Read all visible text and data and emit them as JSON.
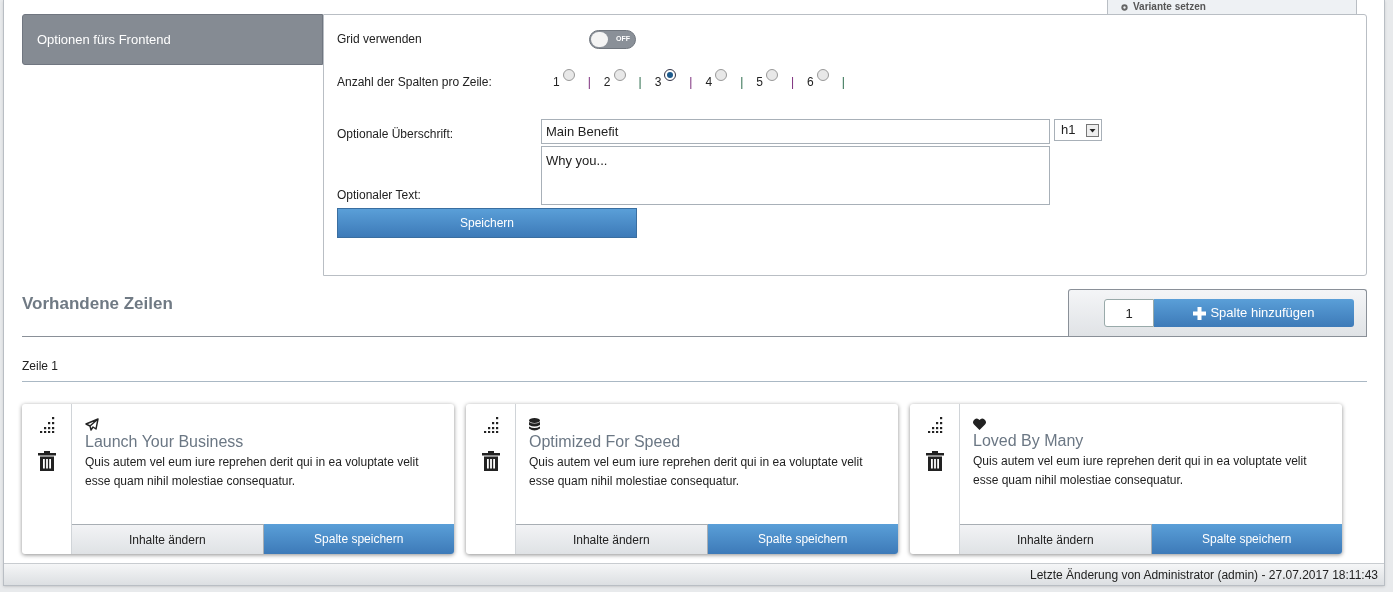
{
  "top_tab": {
    "label": "Variante setzen"
  },
  "options_tab": {
    "label": "Optionen fürs Frontend"
  },
  "grid_toggle": {
    "label": "Grid verwenden",
    "on": false,
    "state_text": "OFF"
  },
  "columns_per_row": {
    "label": "Anzahl der Spalten pro Zeile:",
    "separator": "|",
    "options": [
      {
        "label": "1",
        "selected": false
      },
      {
        "label": "2",
        "selected": false
      },
      {
        "label": "3",
        "selected": true
      },
      {
        "label": "4",
        "selected": false
      },
      {
        "label": "5",
        "selected": false
      },
      {
        "label": "6",
        "selected": false
      }
    ]
  },
  "heading_field": {
    "label": "Optionale Überschrift:",
    "value": "Main Benefit",
    "level": "h1"
  },
  "text_field": {
    "label": "Optionaler Text:",
    "value": "Why you..."
  },
  "save_button": "Speichern",
  "rows_section": {
    "title": "Vorhandene Zeilen",
    "count_value": "1",
    "add_button": "Spalte hinzufügen"
  },
  "rows": [
    {
      "label": "Zeile 1",
      "columns": [
        {
          "kind": "plane",
          "title": "Launch Your Business",
          "text": "Quis autem vel eum iure reprehen derit qui in ea voluptate velit esse quam nihil molestiae consequatur.",
          "edit_button": "Inhalte ändern",
          "save_button": "Spalte speichern"
        },
        {
          "kind": "database",
          "title": "Optimized For Speed",
          "text": "Quis autem vel eum iure reprehen derit qui in ea voluptate velit esse quam nihil molestiae consequatur.",
          "edit_button": "Inhalte ändern",
          "save_button": "Spalte speichern"
        },
        {
          "kind": "heart",
          "title": "Loved By Many",
          "text": "Quis autem vel eum iure reprehen derit qui in ea voluptate velit esse quam nihil molestiae consequatur.",
          "edit_button": "Inhalte ändern",
          "save_button": "Spalte speichern"
        }
      ]
    }
  ],
  "status_bar": "Letzte Änderung von Administrator (admin) - 27.07.2017 18:11:43"
}
